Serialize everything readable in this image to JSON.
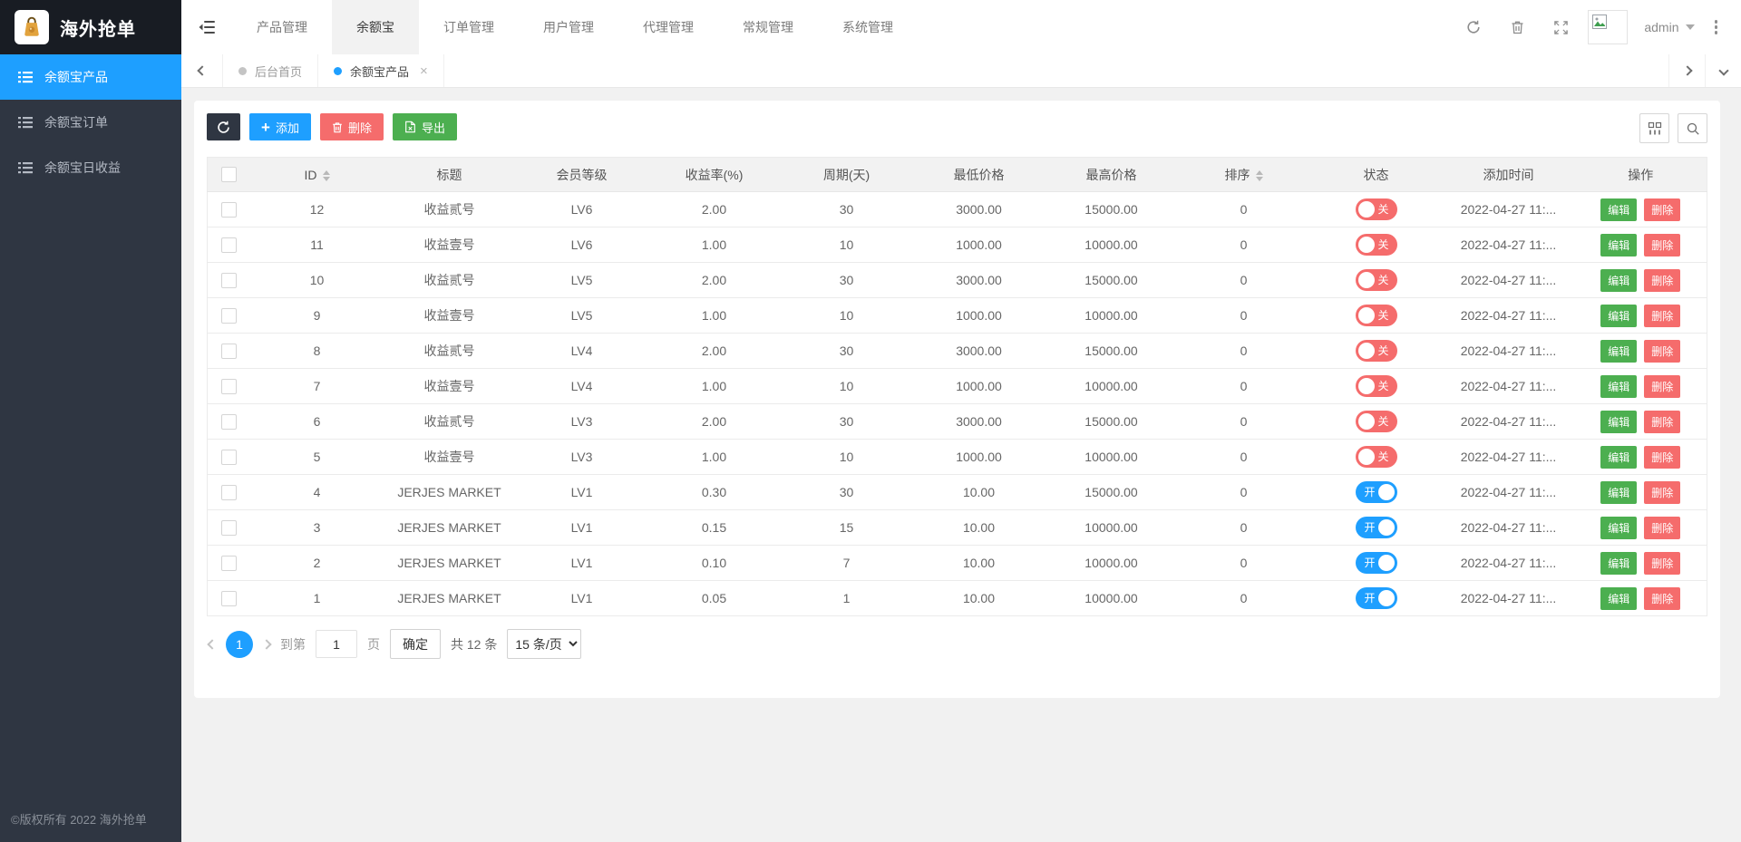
{
  "colors": {
    "accent_blue": "#1E9FFF",
    "danger_red": "#F56C6C",
    "success_green": "#4CAF50",
    "dark": "#2F3642"
  },
  "brand": {
    "title": "海外抢单",
    "logo_icon": "money-bag-icon"
  },
  "topnav": {
    "items": [
      {
        "label": "产品管理",
        "active": false
      },
      {
        "label": "余额宝",
        "active": true
      },
      {
        "label": "订单管理",
        "active": false
      },
      {
        "label": "用户管理",
        "active": false
      },
      {
        "label": "代理管理",
        "active": false
      },
      {
        "label": "常规管理",
        "active": false
      },
      {
        "label": "系统管理",
        "active": false
      }
    ],
    "right": {
      "username": "admin"
    }
  },
  "sidebar": {
    "items": [
      {
        "label": "余额宝产品",
        "active": true
      },
      {
        "label": "余额宝订单",
        "active": false
      },
      {
        "label": "余额宝日收益",
        "active": false
      }
    ],
    "copyright": "©版权所有 2022 海外抢单"
  },
  "tabbar": {
    "tabs": [
      {
        "label": "后台首页",
        "active": false,
        "closable": false
      },
      {
        "label": "余额宝产品",
        "active": true,
        "closable": true
      }
    ],
    "close_glyph": "×"
  },
  "toolbar": {
    "add_plus": "+",
    "add_label": "添加",
    "delete_label": "删除",
    "export_label": "导出"
  },
  "table": {
    "columns": [
      {
        "label": "ID",
        "sortable": true
      },
      {
        "label": "标题",
        "sortable": false
      },
      {
        "label": "会员等级",
        "sortable": false
      },
      {
        "label": "收益率(%)",
        "sortable": false
      },
      {
        "label": "周期(天)",
        "sortable": false
      },
      {
        "label": "最低价格",
        "sortable": false
      },
      {
        "label": "最高价格",
        "sortable": false
      },
      {
        "label": "排序",
        "sortable": true
      },
      {
        "label": "状态",
        "sortable": false
      },
      {
        "label": "添加时间",
        "sortable": false
      },
      {
        "label": "操作",
        "sortable": false
      }
    ],
    "status_labels": {
      "on": "开",
      "off": "关"
    },
    "actions": {
      "edit": "编辑",
      "delete": "删除"
    },
    "rows": [
      {
        "id": "12",
        "title": "收益贰号",
        "level": "LV6",
        "rate": "2.00",
        "period": "30",
        "min_price": "3000.00",
        "max_price": "15000.00",
        "sort": "0",
        "status": "off",
        "time": "2022-04-27 11:..."
      },
      {
        "id": "11",
        "title": "收益壹号",
        "level": "LV6",
        "rate": "1.00",
        "period": "10",
        "min_price": "1000.00",
        "max_price": "10000.00",
        "sort": "0",
        "status": "off",
        "time": "2022-04-27 11:..."
      },
      {
        "id": "10",
        "title": "收益贰号",
        "level": "LV5",
        "rate": "2.00",
        "period": "30",
        "min_price": "3000.00",
        "max_price": "15000.00",
        "sort": "0",
        "status": "off",
        "time": "2022-04-27 11:..."
      },
      {
        "id": "9",
        "title": "收益壹号",
        "level": "LV5",
        "rate": "1.00",
        "period": "10",
        "min_price": "1000.00",
        "max_price": "10000.00",
        "sort": "0",
        "status": "off",
        "time": "2022-04-27 11:..."
      },
      {
        "id": "8",
        "title": "收益贰号",
        "level": "LV4",
        "rate": "2.00",
        "period": "30",
        "min_price": "3000.00",
        "max_price": "15000.00",
        "sort": "0",
        "status": "off",
        "time": "2022-04-27 11:..."
      },
      {
        "id": "7",
        "title": "收益壹号",
        "level": "LV4",
        "rate": "1.00",
        "period": "10",
        "min_price": "1000.00",
        "max_price": "10000.00",
        "sort": "0",
        "status": "off",
        "time": "2022-04-27 11:..."
      },
      {
        "id": "6",
        "title": "收益贰号",
        "level": "LV3",
        "rate": "2.00",
        "period": "30",
        "min_price": "3000.00",
        "max_price": "15000.00",
        "sort": "0",
        "status": "off",
        "time": "2022-04-27 11:..."
      },
      {
        "id": "5",
        "title": "收益壹号",
        "level": "LV3",
        "rate": "1.00",
        "period": "10",
        "min_price": "1000.00",
        "max_price": "10000.00",
        "sort": "0",
        "status": "off",
        "time": "2022-04-27 11:..."
      },
      {
        "id": "4",
        "title": "JERJES MARKET",
        "level": "LV1",
        "rate": "0.30",
        "period": "30",
        "min_price": "10.00",
        "max_price": "15000.00",
        "sort": "0",
        "status": "on",
        "time": "2022-04-27 11:..."
      },
      {
        "id": "3",
        "title": "JERJES MARKET",
        "level": "LV1",
        "rate": "0.15",
        "period": "15",
        "min_price": "10.00",
        "max_price": "10000.00",
        "sort": "0",
        "status": "on",
        "time": "2022-04-27 11:..."
      },
      {
        "id": "2",
        "title": "JERJES MARKET",
        "level": "LV1",
        "rate": "0.10",
        "period": "7",
        "min_price": "10.00",
        "max_price": "10000.00",
        "sort": "0",
        "status": "on",
        "time": "2022-04-27 11:..."
      },
      {
        "id": "1",
        "title": "JERJES MARKET",
        "level": "LV1",
        "rate": "0.05",
        "period": "1",
        "min_price": "10.00",
        "max_price": "10000.00",
        "sort": "0",
        "status": "on",
        "time": "2022-04-27 11:..."
      }
    ]
  },
  "pagination": {
    "current": "1",
    "goto_prefix": "到第",
    "goto_value": "1",
    "goto_suffix": "页",
    "confirm_label": "确定",
    "total_label": "共 12 条",
    "page_size_label": "15 条/页"
  }
}
